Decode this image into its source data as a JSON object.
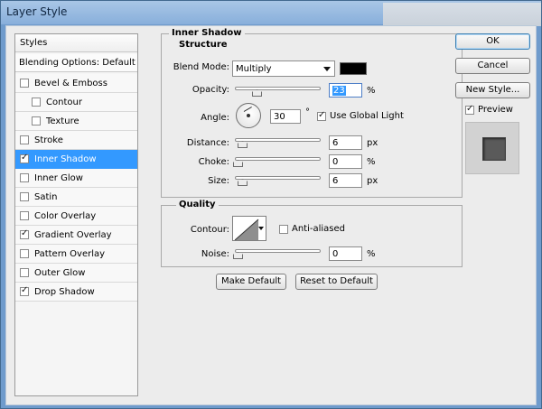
{
  "window": {
    "title": "Layer Style"
  },
  "sidebar": {
    "header": "Styles",
    "blending": "Blending Options: Default",
    "items": [
      {
        "label": "Bevel & Emboss",
        "checked": false,
        "indent": false,
        "selected": false
      },
      {
        "label": "Contour",
        "checked": false,
        "indent": true,
        "selected": false
      },
      {
        "label": "Texture",
        "checked": false,
        "indent": true,
        "selected": false
      },
      {
        "label": "Stroke",
        "checked": false,
        "indent": false,
        "selected": false
      },
      {
        "label": "Inner Shadow",
        "checked": true,
        "indent": false,
        "selected": true
      },
      {
        "label": "Inner Glow",
        "checked": false,
        "indent": false,
        "selected": false
      },
      {
        "label": "Satin",
        "checked": false,
        "indent": false,
        "selected": false
      },
      {
        "label": "Color Overlay",
        "checked": false,
        "indent": false,
        "selected": false
      },
      {
        "label": "Gradient Overlay",
        "checked": true,
        "indent": false,
        "selected": false
      },
      {
        "label": "Pattern Overlay",
        "checked": false,
        "indent": false,
        "selected": false
      },
      {
        "label": "Outer Glow",
        "checked": false,
        "indent": false,
        "selected": false
      },
      {
        "label": "Drop Shadow",
        "checked": true,
        "indent": false,
        "selected": false
      }
    ]
  },
  "inner_shadow": {
    "title": "Inner Shadow",
    "structure": {
      "title": "Structure",
      "blend_mode_label": "Blend Mode:",
      "blend_mode_value": "Multiply",
      "shadow_color": "#000000",
      "opacity_label": "Opacity:",
      "opacity_value": "23",
      "opacity_unit": "%",
      "opacity_level": 0.23,
      "angle_label": "Angle:",
      "angle_value": "30",
      "angle_unit": "°",
      "use_global_light_label": "Use Global Light",
      "use_global_light_checked": true,
      "distance_label": "Distance:",
      "distance_value": "6",
      "distance_unit": "px",
      "distance_level": 0.05,
      "choke_label": "Choke:",
      "choke_value": "0",
      "choke_unit": "%",
      "choke_level": 0.0,
      "size_label": "Size:",
      "size_value": "6",
      "size_unit": "px",
      "size_level": 0.05
    },
    "quality": {
      "title": "Quality",
      "contour_label": "Contour:",
      "anti_aliased_label": "Anti-aliased",
      "anti_aliased_checked": false,
      "noise_label": "Noise:",
      "noise_value": "0",
      "noise_unit": "%",
      "noise_level": 0.0
    },
    "make_default_label": "Make Default",
    "reset_default_label": "Reset to Default"
  },
  "actions": {
    "ok_label": "OK",
    "cancel_label": "Cancel",
    "new_style_label": "New Style...",
    "preview_label": "Preview",
    "preview_checked": true
  }
}
